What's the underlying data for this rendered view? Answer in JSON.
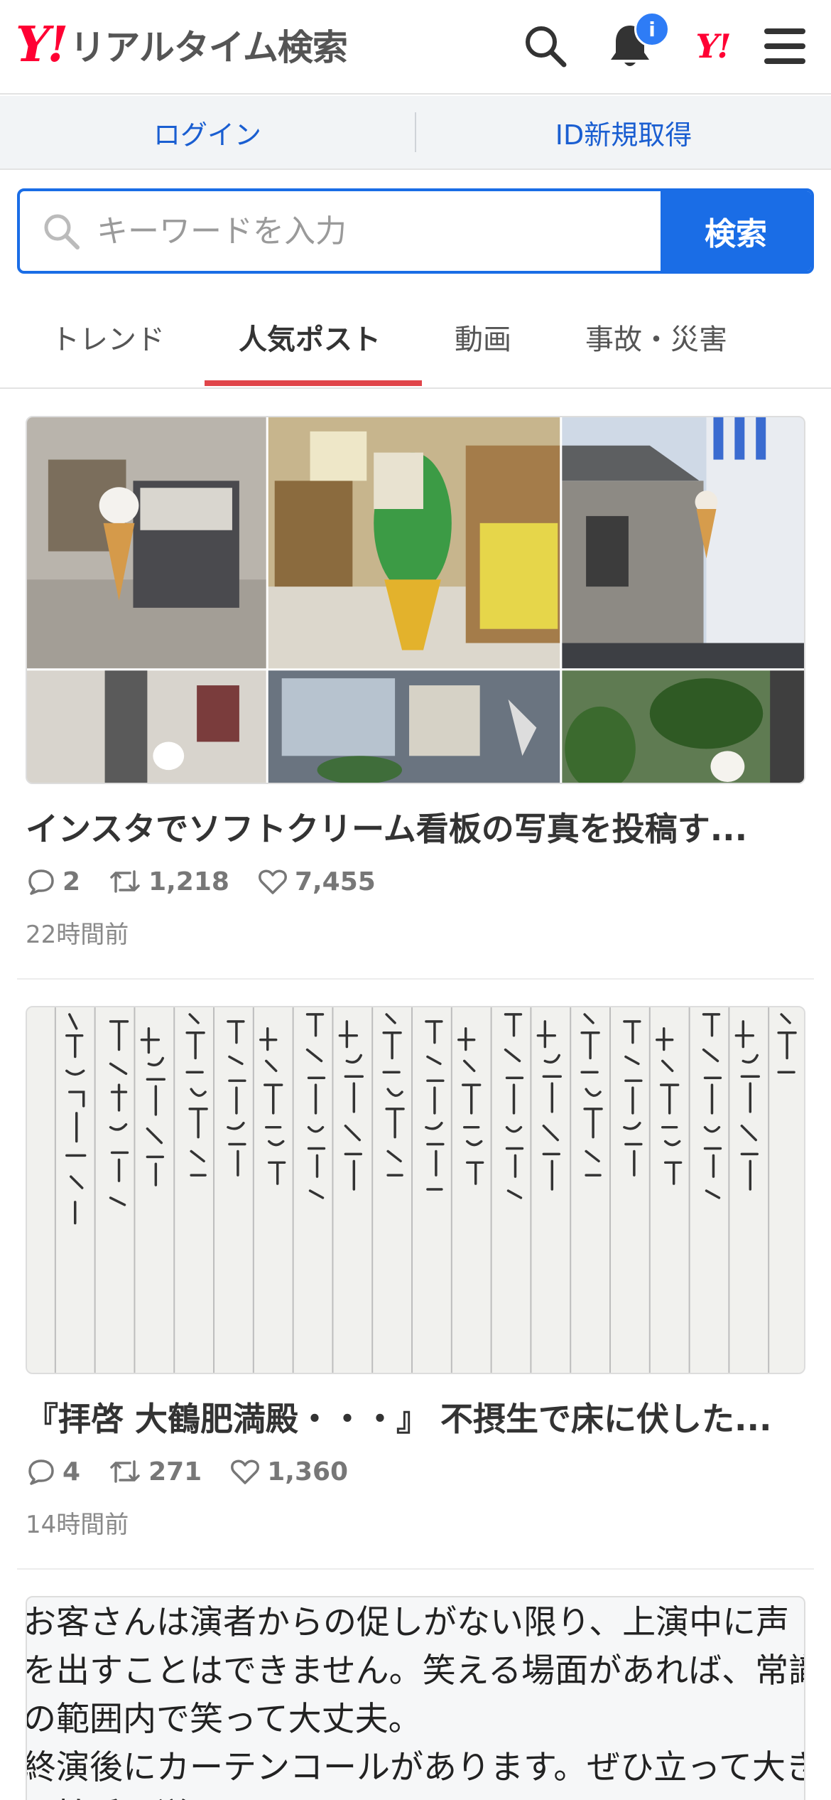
{
  "header": {
    "logo_y": "Y!",
    "logo_text": "リアルタイム検索",
    "notification_badge": "i",
    "yj_logo": "Y!",
    "icons": [
      "search-icon",
      "bell-icon",
      "yahoo-logo",
      "menu-icon"
    ],
    "accent": "#ff0033"
  },
  "loginbar": {
    "login": "ログイン",
    "register": "ID新規取得"
  },
  "search": {
    "placeholder": "キーワードを入力",
    "button": "検索",
    "accent": "#1a6de6"
  },
  "tabs": [
    {
      "label": "トレンド",
      "active": false
    },
    {
      "label": "人気ポスト",
      "active": true
    },
    {
      "label": "動画",
      "active": false
    },
    {
      "label": "事故・災害",
      "active": false
    }
  ],
  "posts": [
    {
      "title": "インスタでソフトクリーム看板の写真を投稿す...",
      "replies": "2",
      "reposts": "1,218",
      "likes": "7,455",
      "time": "22時間前"
    },
    {
      "title": "『拝啓 大鶴肥満殿・・・』 不摂生で床に伏した...",
      "replies": "4",
      "reposts": "271",
      "likes": "1,360",
      "time": "14時間前"
    }
  ],
  "partial_post": {
    "lines": [
      "お客さんは演者からの促しがない限り、上演中に声",
      "を出すことはできません。笑える場面があれば、常識",
      "の範囲内で笑って大丈夫。",
      "終演後にカーテンコールがあります。ぜひ立って大き",
      "な拍手を送ってください。"
    ]
  }
}
